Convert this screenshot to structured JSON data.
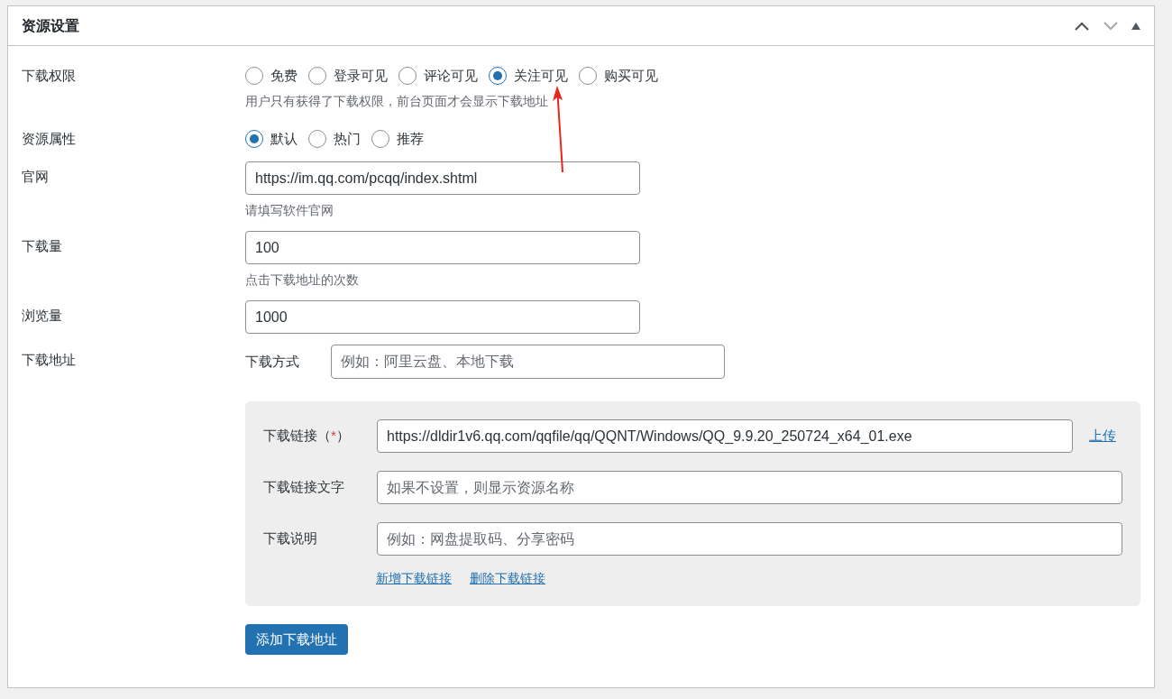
{
  "panel": {
    "title": "资源设置"
  },
  "fields": [
    {
      "kind": "radio",
      "label": "下载权限",
      "options": [
        {
          "label": "免费",
          "selected": false
        },
        {
          "label": "登录可见",
          "selected": false
        },
        {
          "label": "评论可见",
          "selected": false
        },
        {
          "label": "关注可见",
          "selected": true
        },
        {
          "label": "购买可见",
          "selected": false
        }
      ],
      "hint": "用户只有获得了下载权限，前台页面才会显示下载地址"
    },
    {
      "kind": "radio",
      "label": "资源属性",
      "options": [
        {
          "label": "默认",
          "selected": true
        },
        {
          "label": "热门",
          "selected": false
        },
        {
          "label": "推荐",
          "selected": false
        }
      ]
    },
    {
      "kind": "text",
      "label": "官网",
      "value": "https://im.qq.com/pcqq/index.shtml",
      "hint": "请填写软件官网"
    },
    {
      "kind": "text",
      "label": "下载量",
      "value": "100",
      "hint": "点击下载地址的次数"
    },
    {
      "kind": "text",
      "label": "浏览量",
      "value": "1000"
    },
    {
      "kind": "download",
      "label": "下载地址",
      "method": {
        "label": "下载方式",
        "placeholder": "例如：阿里云盘、本地下载"
      },
      "link_group": {
        "rows": [
          {
            "label": "下载链接",
            "required_open": "（",
            "required_mark": "*",
            "required_close": "）",
            "value": "https://dldir1v6.qq.com/qqfile/qq/QQNT/Windows/QQ_9.9.20_250724_x64_01.exe",
            "action": "上传"
          },
          {
            "label": "下载链接文字",
            "placeholder": "如果不设置，则显示资源名称"
          },
          {
            "label": "下载说明",
            "placeholder": "例如：网盘提取码、分享密码"
          }
        ],
        "links": [
          "新增下载链接",
          "删除下载链接"
        ]
      },
      "add_button": "添加下载地址"
    }
  ]
}
